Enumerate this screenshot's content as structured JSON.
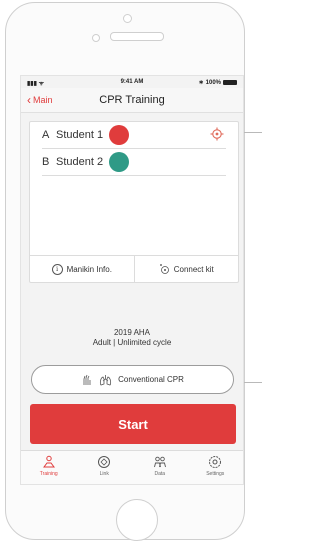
{
  "status": {
    "time": "9:41 AM",
    "battery": "100%"
  },
  "nav": {
    "back_label": "Main",
    "title": "CPR Training"
  },
  "students": [
    {
      "letter": "A",
      "name": "Student 1",
      "color": "#e03c3c"
    },
    {
      "letter": "B",
      "name": "Student 2",
      "color": "#2f9a86"
    }
  ],
  "card_footer": {
    "manikin_label": "Manikin Info.",
    "connect_label": "Connect kit"
  },
  "mode": {
    "line1": "2019 AHA",
    "line2": "Adult | Unlimited cycle"
  },
  "cpr_button": {
    "label": "Conventional CPR"
  },
  "start_button": {
    "label": "Start"
  },
  "tabs": [
    {
      "label": "Training",
      "icon": "training-icon",
      "active": true
    },
    {
      "label": "Link",
      "icon": "link-icon",
      "active": false
    },
    {
      "label": "Data",
      "icon": "data-icon",
      "active": false
    },
    {
      "label": "Settings",
      "icon": "settings-icon",
      "active": false
    }
  ],
  "colors": {
    "accent": "#e03c3c",
    "teal": "#2f9a86"
  }
}
